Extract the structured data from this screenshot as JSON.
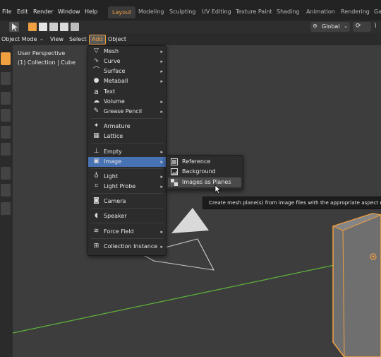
{
  "topbar": {
    "menus": [
      "File",
      "Edit",
      "Render",
      "Window",
      "Help"
    ],
    "workspaces": [
      "Layout",
      "Modeling",
      "Sculpting",
      "UV Editing",
      "Texture Paint",
      "Shading",
      "Animation",
      "Rendering",
      "Ga"
    ],
    "active_workspace": "Layout"
  },
  "header": {
    "transform_orientation": "Global"
  },
  "row2": {
    "mode": "Object Mode",
    "view": "View",
    "select": "Select",
    "add": "Add",
    "object": "Object"
  },
  "viewport": {
    "perspective_label": "User Perspective",
    "collection_label": "(1) Collection | Cube"
  },
  "add_menu": {
    "items": [
      {
        "label": "Mesh",
        "icon": "mesh-icon",
        "submenu": true
      },
      {
        "label": "Curve",
        "icon": "curve-icon",
        "submenu": true
      },
      {
        "label": "Surface",
        "icon": "surface-icon",
        "submenu": true
      },
      {
        "label": "Metaball",
        "icon": "metaball-icon",
        "submenu": true
      },
      {
        "label": "Text",
        "icon": "text-icon",
        "submenu": false
      },
      {
        "label": "Volume",
        "icon": "volume-icon",
        "submenu": true
      },
      {
        "label": "Grease Pencil",
        "icon": "grease-pencil-icon",
        "submenu": true
      },
      {
        "label": "Armature",
        "icon": "armature-icon",
        "submenu": false
      },
      {
        "label": "Lattice",
        "icon": "lattice-icon",
        "submenu": false
      },
      {
        "label": "Empty",
        "icon": "empty-icon",
        "submenu": true
      },
      {
        "label": "Image",
        "icon": "image-icon",
        "submenu": true
      },
      {
        "label": "Light",
        "icon": "light-icon",
        "submenu": true
      },
      {
        "label": "Light Probe",
        "icon": "light-probe-icon",
        "submenu": true
      },
      {
        "label": "Camera",
        "icon": "camera-icon",
        "submenu": false
      },
      {
        "label": "Speaker",
        "icon": "speaker-icon",
        "submenu": false
      },
      {
        "label": "Force Field",
        "icon": "force-field-icon",
        "submenu": true
      },
      {
        "label": "Collection Instance",
        "icon": "collection-instance-icon",
        "submenu": true
      }
    ],
    "highlighted": "Image"
  },
  "image_submenu": {
    "items": [
      "Reference",
      "Background",
      "Images as Planes"
    ],
    "hovered": "Images as Planes"
  },
  "tooltip": {
    "text": "Create mesh plane(s) from image files with the appropriate aspect ratio."
  }
}
